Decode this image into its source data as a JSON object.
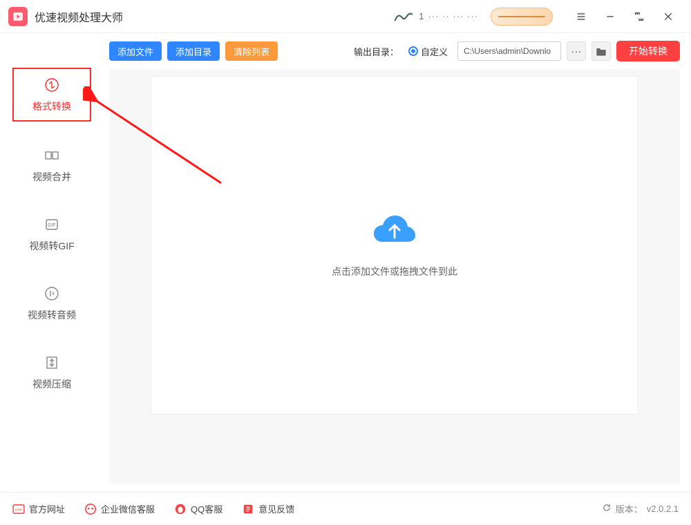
{
  "app": {
    "title": "优速视频处理大师"
  },
  "titlebar": {
    "user_text": "1"
  },
  "sidebar": {
    "items": [
      {
        "label": "格式转换"
      },
      {
        "label": "视频合并"
      },
      {
        "label": "视频转GIF"
      },
      {
        "label": "视频转音频"
      },
      {
        "label": "视频压缩"
      }
    ]
  },
  "toolbar": {
    "add_file": "添加文件",
    "add_dir": "添加目录",
    "clear_list": "清除列表",
    "output_label": "输出目录：",
    "radio_custom": "自定义",
    "path_value": "C:\\Users\\admin\\Downlo",
    "more": "···",
    "start": "开始转换"
  },
  "drop": {
    "hint": "点击添加文件或拖拽文件到此"
  },
  "footer": {
    "site": "官方网址",
    "wecom": "企业微信客服",
    "qq": "QQ客服",
    "feedback": "意见反馈",
    "version_label": "版本：",
    "version": "v2.0.2.1"
  }
}
